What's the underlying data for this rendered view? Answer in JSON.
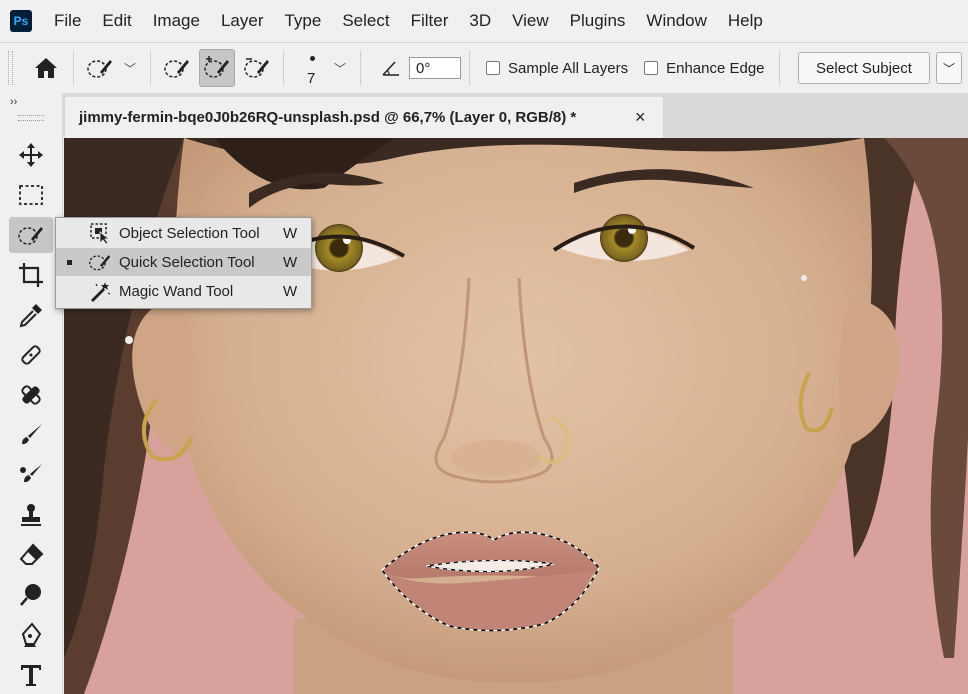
{
  "app": {
    "logo": "Ps"
  },
  "menubar": {
    "items": [
      "File",
      "Edit",
      "Image",
      "Layer",
      "Type",
      "Select",
      "Filter",
      "3D",
      "View",
      "Plugins",
      "Window",
      "Help"
    ]
  },
  "options": {
    "brush_size": "7",
    "angle_value": "0°",
    "sample_all_layers": "Sample All Layers",
    "enhance_edge": "Enhance Edge",
    "select_subject": "Select Subject"
  },
  "toolbar": {
    "collapse_label": "››"
  },
  "document": {
    "tab_title": "jimmy-fermin-bqe0J0b26RQ-unsplash.psd @ 66,7% (Layer 0, RGB/8) *",
    "close": "×"
  },
  "flyout": {
    "items": [
      {
        "label": "Object Selection Tool",
        "shortcut": "W",
        "icon": "object-selection-icon"
      },
      {
        "label": "Quick Selection Tool",
        "shortcut": "W",
        "icon": "quick-selection-icon",
        "selected": true
      },
      {
        "label": "Magic Wand Tool",
        "shortcut": "W",
        "icon": "magic-wand-icon"
      }
    ]
  },
  "colors": {
    "background_pink": "#d9a19b",
    "skin": "#d8b596",
    "lip": "#c98e80",
    "eye": "#a08a2a",
    "hair": "#3a2a22"
  }
}
